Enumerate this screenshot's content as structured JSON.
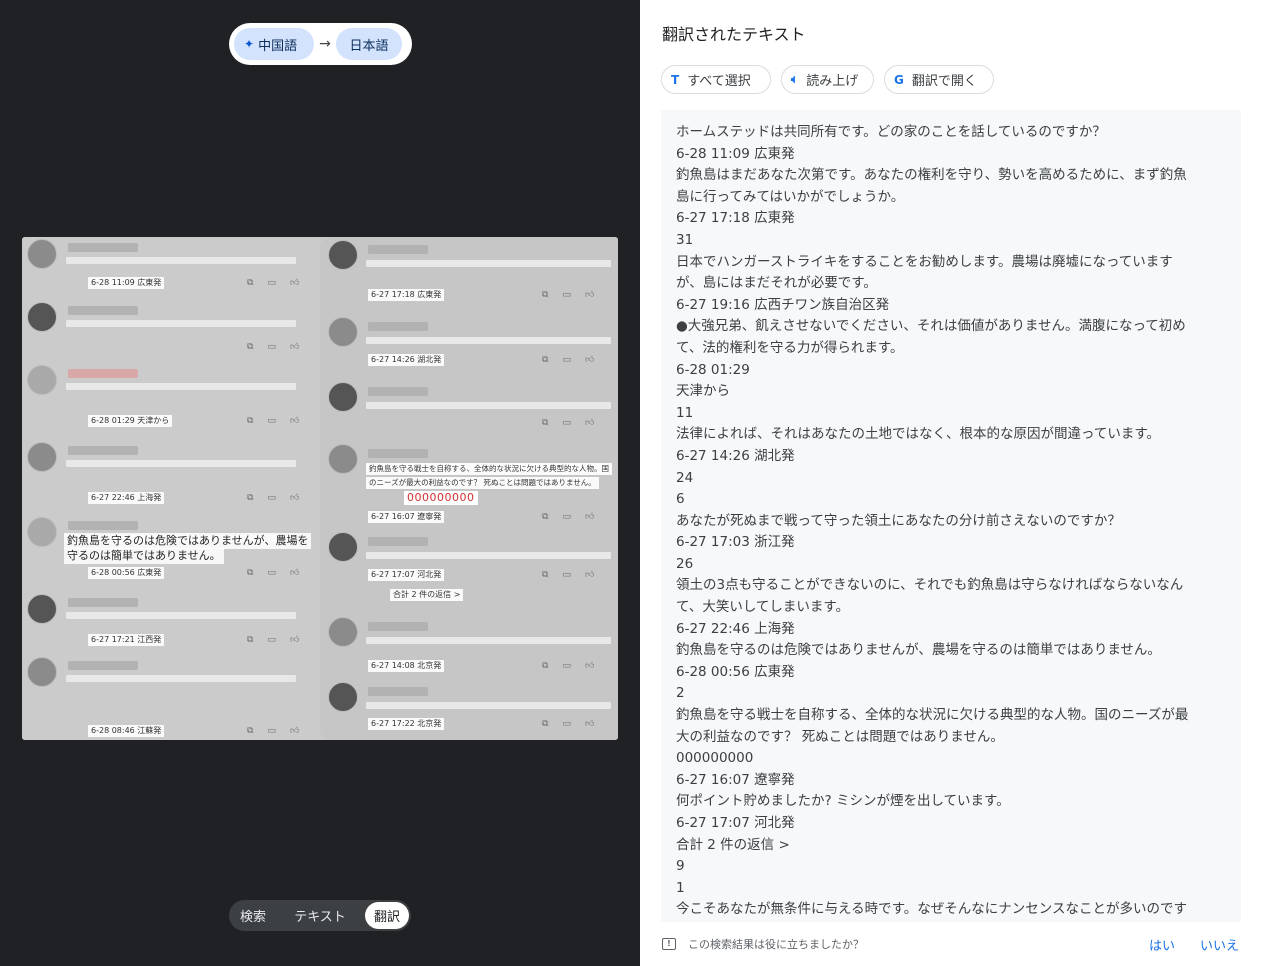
{
  "viewer": {
    "source_lang": "中国語",
    "target_lang": "日本語",
    "arrow": "→",
    "modes": {
      "search": "検索",
      "text": "テキスト",
      "translate": "翻訳"
    }
  },
  "screenshot": {
    "left_metas": [
      "6-28 11:09 広東発",
      "6-28 01:29 天津から",
      "6-27 22:46 上海発",
      "6-28 00:56 広東発",
      "6-27 17:21 江西発",
      "6-28 08:46 江蘇発"
    ],
    "right_metas": [
      "6-27 17:18 広東発",
      "6-27 14:26 湖北発",
      "6-27 17:03 浙江発",
      "6-27 16:07 遼寧発",
      "6-27 17:07 河北発",
      "6-27 14:08 北京発",
      "6-27 17:22 北京発"
    ],
    "overlay_left_big": [
      "釣魚島を守るのは危険ではありませんが、農場を",
      "守るのは簡単ではありません。"
    ],
    "overlay_right_text1": "釣魚島を守る戦士を自称する、全体的な状況に欠ける典型的な人物。国",
    "overlay_right_text2": "のニーズが最大の利益なのです？ 死ぬことは問題ではありません。",
    "red_number": "000000000",
    "replies": "合計 2 件の返信 >"
  },
  "panel": {
    "title": "翻訳されたテキスト",
    "buttons": {
      "select_all": "すべて選択",
      "read_aloud": "読み上げ",
      "open_translate": "翻訳で開く"
    },
    "lines": [
      "ホームステッドは共同所有です。どの家のことを話しているのですか？",
      "6-28 11:09 広東発",
      "釣魚島はまだあなた次第です。あなたの権利を守り、勢いを高めるために、まず釣魚",
      "島に行ってみてはいかがでしょうか。",
      "6-27 17:18 広東発",
      "31",
      "日本でハンガーストライキをすることをお勧めします。農場は廃墟になっています",
      "が、島にはまだそれが必要です。",
      "6-27 19:16 広西チワン族自治区発",
      "●大強兄弟、飢えさせないでください、それは価値がありません。満腹になって初め",
      "て、法的権利を守る力が得られます。",
      "6-28 01:29",
      "天津から",
      "11",
      "法律によれば、それはあなたの土地ではなく、根本的な原因が間違っています。",
      "6-27 14:26 湖北発",
      "24",
      "6",
      "あなたが死ぬまで戦って守った領土にあなたの分け前さえないのですか？",
      "6-27 17:03 浙江発",
      "26",
      "領土の3点も守ることができないのに、それでも釣魚島は守らなければならないなん",
      "て、大笑いしてしまいます。",
      "6-27 22:46 上海発",
      "釣魚島を守るのは危険ではありませんが、農場を守るのは簡単ではありません。",
      "6-28 00:56 広東発",
      "2",
      "釣魚島を守る戦士を自称する、全体的な状況に欠ける典型的な人物。国のニーズが最",
      "大の利益なのです？ 死ぬことは問題ではありません。",
      "000000000",
      "6-27 16:07 遼寧発",
      "何ポイント貯めましたか? ミシンが煙を出しています。",
      "6-27 17:07 河北発",
      "合計 2 件の返信 >",
      "9",
      "1",
      "今こそあなたが無条件に与える時です。なぜそんなにナンセンスなことが多いのです"
    ],
    "feedback": {
      "question": "この検索結果は役に立ちましたか？",
      "yes": "はい",
      "no": "いいえ"
    }
  }
}
